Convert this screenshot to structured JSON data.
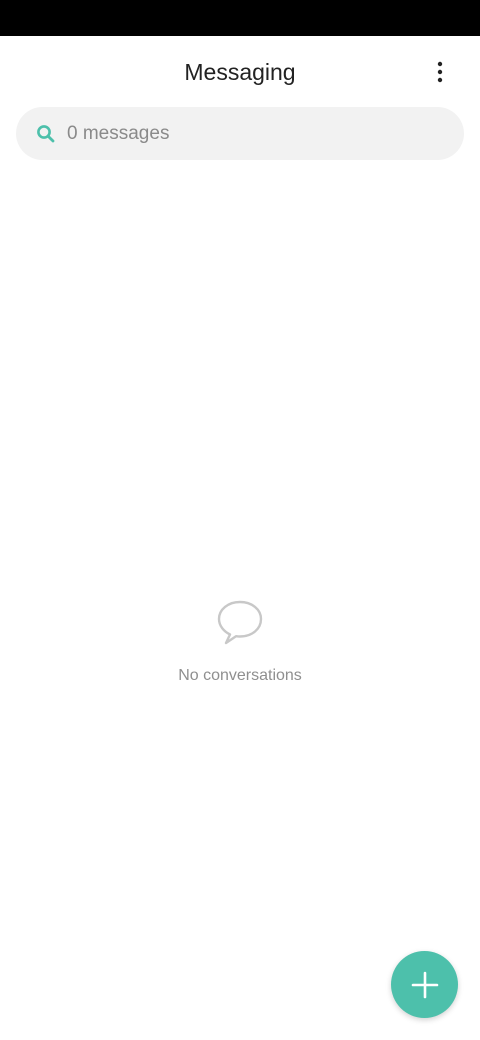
{
  "app_bar": {
    "title": "Messaging",
    "more_icon": "more-vertical-icon"
  },
  "search": {
    "placeholder": "0 messages",
    "value": "",
    "icon": "search-icon"
  },
  "empty_state": {
    "icon": "chat-bubble-icon",
    "text": "No conversations"
  },
  "fab": {
    "icon": "plus-icon"
  },
  "colors": {
    "accent": "#4dc0ab",
    "status_bar": "#000000",
    "search_background": "#f2f2f2",
    "muted_text": "#8f8f8f"
  }
}
